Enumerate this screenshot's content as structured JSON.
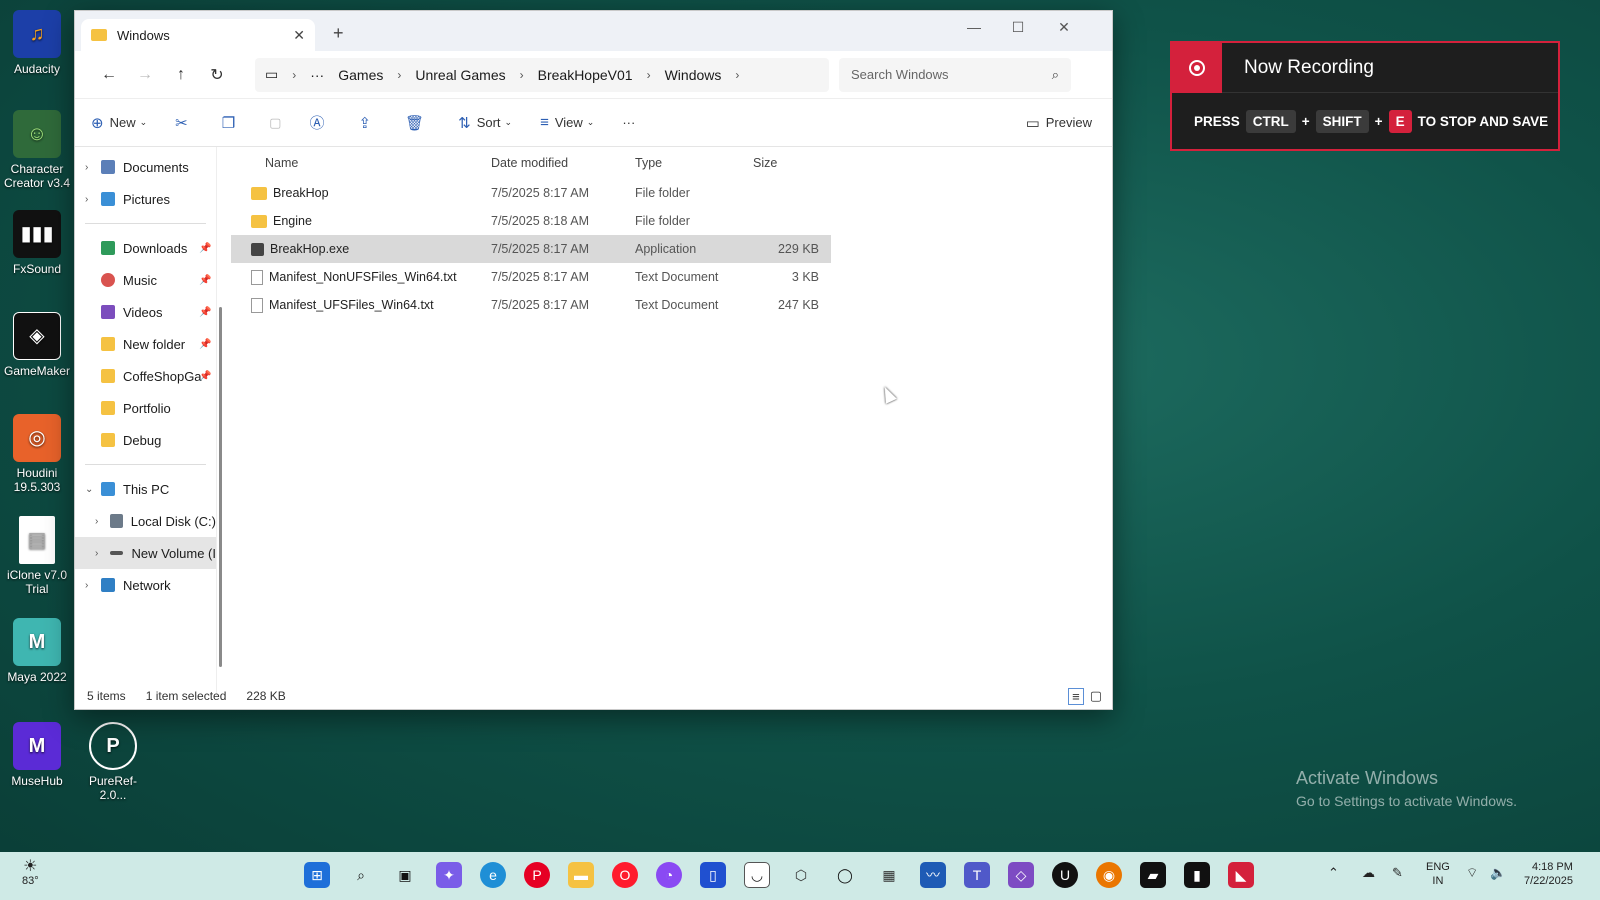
{
  "desktop": {
    "icons": [
      {
        "label": "Audacity"
      },
      {
        "label": "Character Creator v3.4"
      },
      {
        "label": "FxSound"
      },
      {
        "label": "GameMaker"
      },
      {
        "label": "Houdini 19.5.303"
      },
      {
        "label": "iClone v7.0 Trial"
      },
      {
        "label": "Maya 2022"
      },
      {
        "label": "MuseHub"
      },
      {
        "label": "PureRef-2.0..."
      }
    ]
  },
  "window": {
    "tab_title": "Windows",
    "close_tab": "✕",
    "new_tab": "+",
    "controls": {
      "minimize": "—",
      "maximize": "☐",
      "close": "✕"
    },
    "breadcrumb": [
      "Games",
      "Unreal Games",
      "BreakHopeV01",
      "Windows"
    ],
    "breadcrumb_more": "···",
    "search_placeholder": "Search Windows",
    "toolbar": {
      "new": "New",
      "sort": "Sort",
      "view": "View",
      "more": "···",
      "preview": "Preview"
    },
    "nav": {
      "items": [
        {
          "label": "Documents"
        },
        {
          "label": "Pictures"
        },
        {
          "label": "Downloads"
        },
        {
          "label": "Music"
        },
        {
          "label": "Videos"
        },
        {
          "label": "New folder"
        },
        {
          "label": "CoffeShopGa"
        },
        {
          "label": "Portfolio"
        },
        {
          "label": "Debug"
        },
        {
          "label": "This PC"
        },
        {
          "label": "Local Disk (C:)"
        },
        {
          "label": "New Volume (I"
        },
        {
          "label": "Network"
        }
      ]
    },
    "columns": {
      "name": "Name",
      "date": "Date modified",
      "type": "Type",
      "size": "Size"
    },
    "files": [
      {
        "name": "BreakHop",
        "date": "7/5/2025 8:17 AM",
        "type": "File folder",
        "size": ""
      },
      {
        "name": "Engine",
        "date": "7/5/2025 8:18 AM",
        "type": "File folder",
        "size": ""
      },
      {
        "name": "BreakHop.exe",
        "date": "7/5/2025 8:17 AM",
        "type": "Application",
        "size": "229 KB"
      },
      {
        "name": "Manifest_NonUFSFiles_Win64.txt",
        "date": "7/5/2025 8:17 AM",
        "type": "Text Document",
        "size": "3 KB"
      },
      {
        "name": "Manifest_UFSFiles_Win64.txt",
        "date": "7/5/2025 8:17 AM",
        "type": "Text Document",
        "size": "247 KB"
      }
    ],
    "status": {
      "items": "5 items",
      "selected": "1 item selected",
      "size": "228 KB"
    }
  },
  "recording": {
    "title": "Now Recording",
    "press": "PRESS",
    "key1": "CTRL",
    "key2": "SHIFT",
    "key3": "E",
    "plus": "+",
    "suffix": "TO STOP AND SAVE"
  },
  "watermark": {
    "line1": "Activate Windows",
    "line2": "Go to Settings to activate Windows."
  },
  "taskbar": {
    "weather": "83°",
    "lang1": "ENG",
    "lang2": "IN",
    "time": "4:18 PM",
    "date": "7/22/2025"
  }
}
